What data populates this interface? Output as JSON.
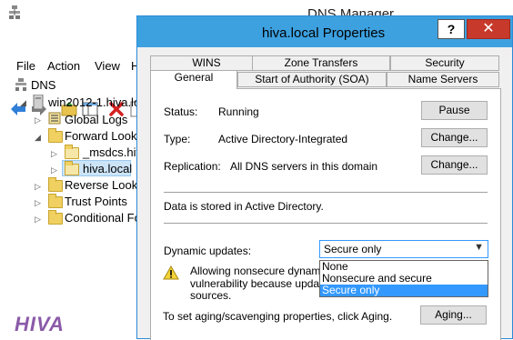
{
  "dns_manager": {
    "title": "DNS Manager",
    "menu": [
      "File",
      "Action",
      "View",
      "H"
    ],
    "tree": {
      "root": "DNS",
      "server": "win2012-1.hiva.loc",
      "global_logs": "Global Logs",
      "forward": "Forward Looku",
      "msdcs": "_msdcs.hiv",
      "zone": "hiva.local",
      "reverse": "Reverse Lookup",
      "trust": "Trust Points",
      "conditional": "Conditional Fo"
    },
    "logo_text": "HIVA"
  },
  "dialog": {
    "title": "hiva.local Properties",
    "help": "?",
    "close": "✕",
    "tabs_row1": [
      "WINS",
      "Zone Transfers",
      "Security"
    ],
    "tabs_row2": [
      "General",
      "Start of Authority (SOA)",
      "Name Servers"
    ],
    "active_tab": "General",
    "status_label": "Status:",
    "status_value": "Running",
    "pause_button": "Pause",
    "type_label": "Type:",
    "type_value": "Active Directory-Integrated",
    "type_change": "Change...",
    "replication_label": "Replication:",
    "replication_value": "All DNS servers in this domain",
    "replication_change": "Change...",
    "stored_text": "Data is stored in Active Directory.",
    "dynamic_label": "Dynamic updates:",
    "dynamic_value": "Secure only",
    "dynamic_options": [
      "None",
      "Nonsecure and secure",
      "Secure only"
    ],
    "warning_line1": "Allowing nonsecure dynamic u",
    "warning_line2": "vulnerability because updates",
    "warning_line3": "sources.",
    "aging_text": "To set aging/scavenging properties, click Aging.",
    "aging_button": "Aging..."
  },
  "colors": {
    "titlebar": "#3da1e0",
    "close": "#c7392b",
    "selection": "#3399ff"
  }
}
